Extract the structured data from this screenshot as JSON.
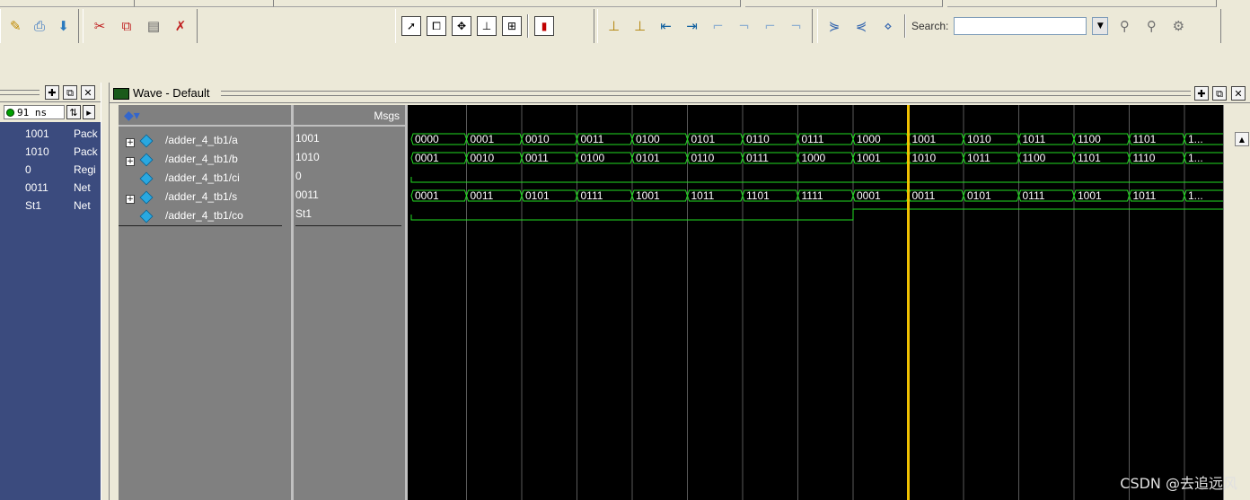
{
  "toolbar": {
    "search_label": "Search:",
    "search_value": ""
  },
  "objects": {
    "now_time": "91 ns",
    "rows": [
      {
        "value": "1001",
        "kind": "Pack"
      },
      {
        "value": "1010",
        "kind": "Pack"
      },
      {
        "value": "0",
        "kind": "Regi"
      },
      {
        "value": "0011",
        "kind": "Net"
      },
      {
        "value": "St1",
        "kind": "Net"
      }
    ]
  },
  "wave": {
    "title": "Wave - Default",
    "msgs_header": "Msgs",
    "signals": [
      {
        "name": "/adder_4_tb1/a",
        "value": "1001",
        "expandable": true,
        "type": "bus",
        "segments": [
          "0000",
          "0001",
          "0010",
          "0011",
          "0100",
          "0101",
          "0110",
          "0111",
          "1000",
          "1001",
          "1010",
          "1011",
          "1100",
          "1101",
          "1..."
        ]
      },
      {
        "name": "/adder_4_tb1/b",
        "value": "1010",
        "expandable": true,
        "type": "bus",
        "segments": [
          "0001",
          "0010",
          "0011",
          "0100",
          "0101",
          "0110",
          "0111",
          "1000",
          "1001",
          "1010",
          "1011",
          "1100",
          "1101",
          "1110",
          "1..."
        ]
      },
      {
        "name": "/adder_4_tb1/ci",
        "value": "0",
        "expandable": false,
        "type": "bit",
        "levels": [
          0,
          0,
          0,
          0,
          0,
          0,
          0,
          0,
          0,
          0,
          0,
          0,
          0,
          0,
          0
        ]
      },
      {
        "name": "/adder_4_tb1/s",
        "value": "0011",
        "expandable": true,
        "type": "bus",
        "segments": [
          "0001",
          "0011",
          "0101",
          "0111",
          "1001",
          "1011",
          "1101",
          "1111",
          "0001",
          "0011",
          "0101",
          "0111",
          "1001",
          "1011",
          "1..."
        ]
      },
      {
        "name": "/adder_4_tb1/co",
        "value": "St1",
        "expandable": false,
        "type": "bit",
        "levels": [
          0,
          0,
          0,
          0,
          0,
          0,
          0,
          0,
          1,
          1,
          1,
          1,
          1,
          1,
          1
        ]
      }
    ],
    "cursor_segment": 9.0
  },
  "watermark": "CSDN @去追远风"
}
